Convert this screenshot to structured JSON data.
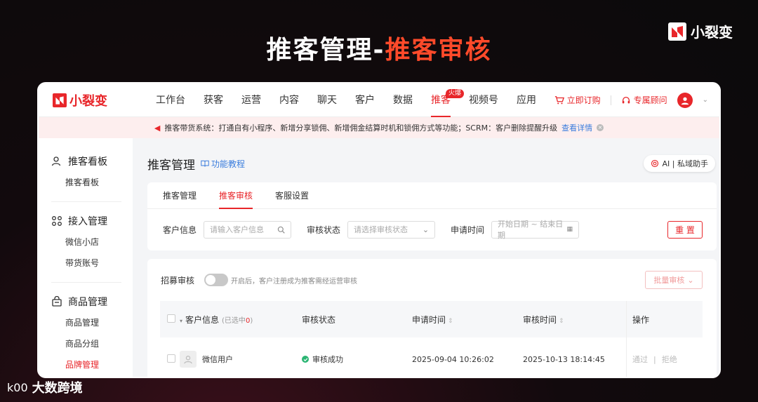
{
  "slide": {
    "title_part1": "推客管理-",
    "title_part2": "推客审核",
    "brand_name": "小裂变",
    "footer_brand": "大数跨境",
    "footer_logo_text": "k00"
  },
  "app": {
    "logo_name": "小裂变",
    "nav": [
      "工作台",
      "获客",
      "运营",
      "内容",
      "聊天",
      "客户",
      "数据",
      "推客",
      "视频号",
      "应用"
    ],
    "nav_active": "推客",
    "hot_badge": "火爆",
    "order_label": "立即订购",
    "advisor_label": "专属顾问",
    "accent_color": "#e8262a"
  },
  "notice": {
    "text": "推客带货系统：打通自有小程序、新增分享锁佣、新增佣金结算时机和锁佣方式等功能；SCRM：客户删除提醒升级",
    "link": "查看详情"
  },
  "sidebar": {
    "groups": [
      {
        "title": "推客看板",
        "icon": "user-icon",
        "items": [
          "推客看板"
        ]
      },
      {
        "title": "接入管理",
        "icon": "grid-icon",
        "items": [
          "微信小店",
          "带货账号"
        ]
      },
      {
        "title": "商品管理",
        "icon": "bag-icon",
        "items": [
          "商品管理",
          "商品分组",
          "品牌管理"
        ]
      }
    ]
  },
  "main": {
    "page_title": "推客管理",
    "tutorial": "功能教程",
    "ai_label": "AI | 私域助手",
    "tabs": [
      "推客管理",
      "推客审核",
      "客服设置"
    ],
    "active_tab": "推客审核",
    "filters": {
      "customer_label": "客户信息",
      "customer_placeholder": "请输入客户信息",
      "status_label": "审核状态",
      "status_placeholder": "请选择审核状态",
      "date_label": "申请时间",
      "date_placeholder": "开始日期 ~ 结束日期",
      "reset": "重 置"
    },
    "recruit": {
      "label": "招募审核",
      "note": "开启后，客户注册成为推客需经运营审核",
      "batch": "批量审核"
    },
    "table": {
      "headers": {
        "customer": "客户信息",
        "selected_prefix": "(已选中",
        "selected_count": "0",
        "selected_suffix": ")",
        "status": "审核状态",
        "apply_time": "申请时间",
        "review_time": "审核时间",
        "ops": "操作"
      },
      "rows": [
        {
          "name": "微信用户",
          "status": "审核成功",
          "apply_time": "2025-09-04 10:26:02",
          "review_time": "2025-10-13 18:14:45",
          "op_pass": "通过",
          "op_reject": "拒绝"
        }
      ]
    }
  }
}
